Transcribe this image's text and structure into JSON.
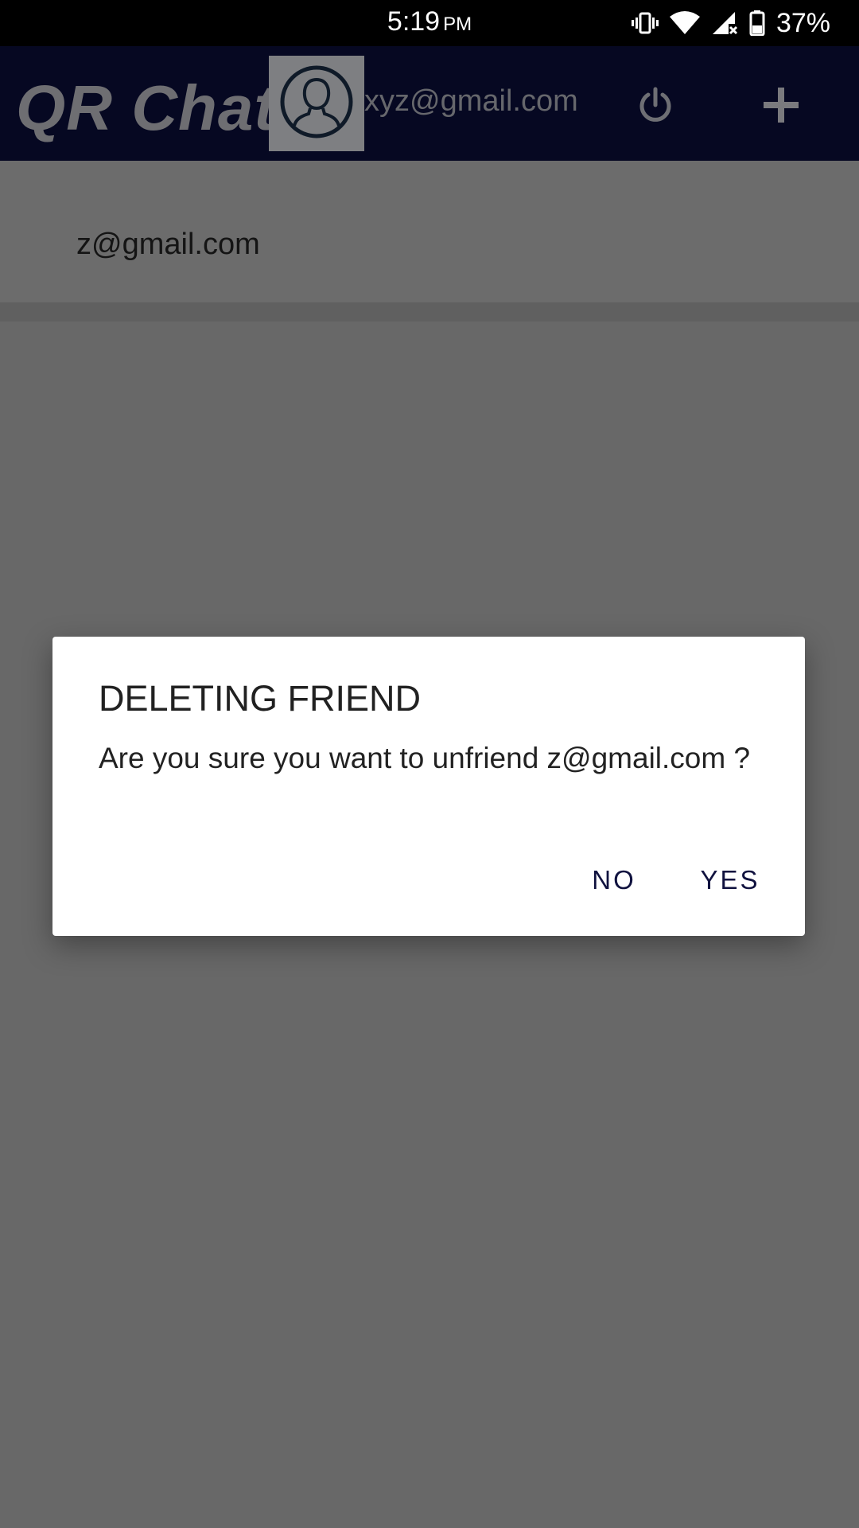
{
  "status_bar": {
    "time": "5:19",
    "ampm": "PM",
    "battery_percent": "37%",
    "icons": [
      "vibrate-icon",
      "wifi-icon",
      "signal-icon",
      "battery-icon"
    ]
  },
  "app_bar": {
    "title": "QR Chat",
    "user_email": "xyz@gmail.com",
    "avatar_icon": "user-avatar-icon",
    "power_icon": "power-icon",
    "add_icon": "add-icon"
  },
  "friends_list": {
    "items": [
      {
        "email": "z@gmail.com"
      }
    ]
  },
  "dialog": {
    "title": "DELETING FRIEND",
    "message": "Are you sure you want to unfriend z@gmail.com ?",
    "no_label": "NO",
    "yes_label": "YES"
  },
  "colors": {
    "app_bar_bg": "#060822",
    "scrim": "#686868",
    "dialog_button_text": "#10123f"
  }
}
